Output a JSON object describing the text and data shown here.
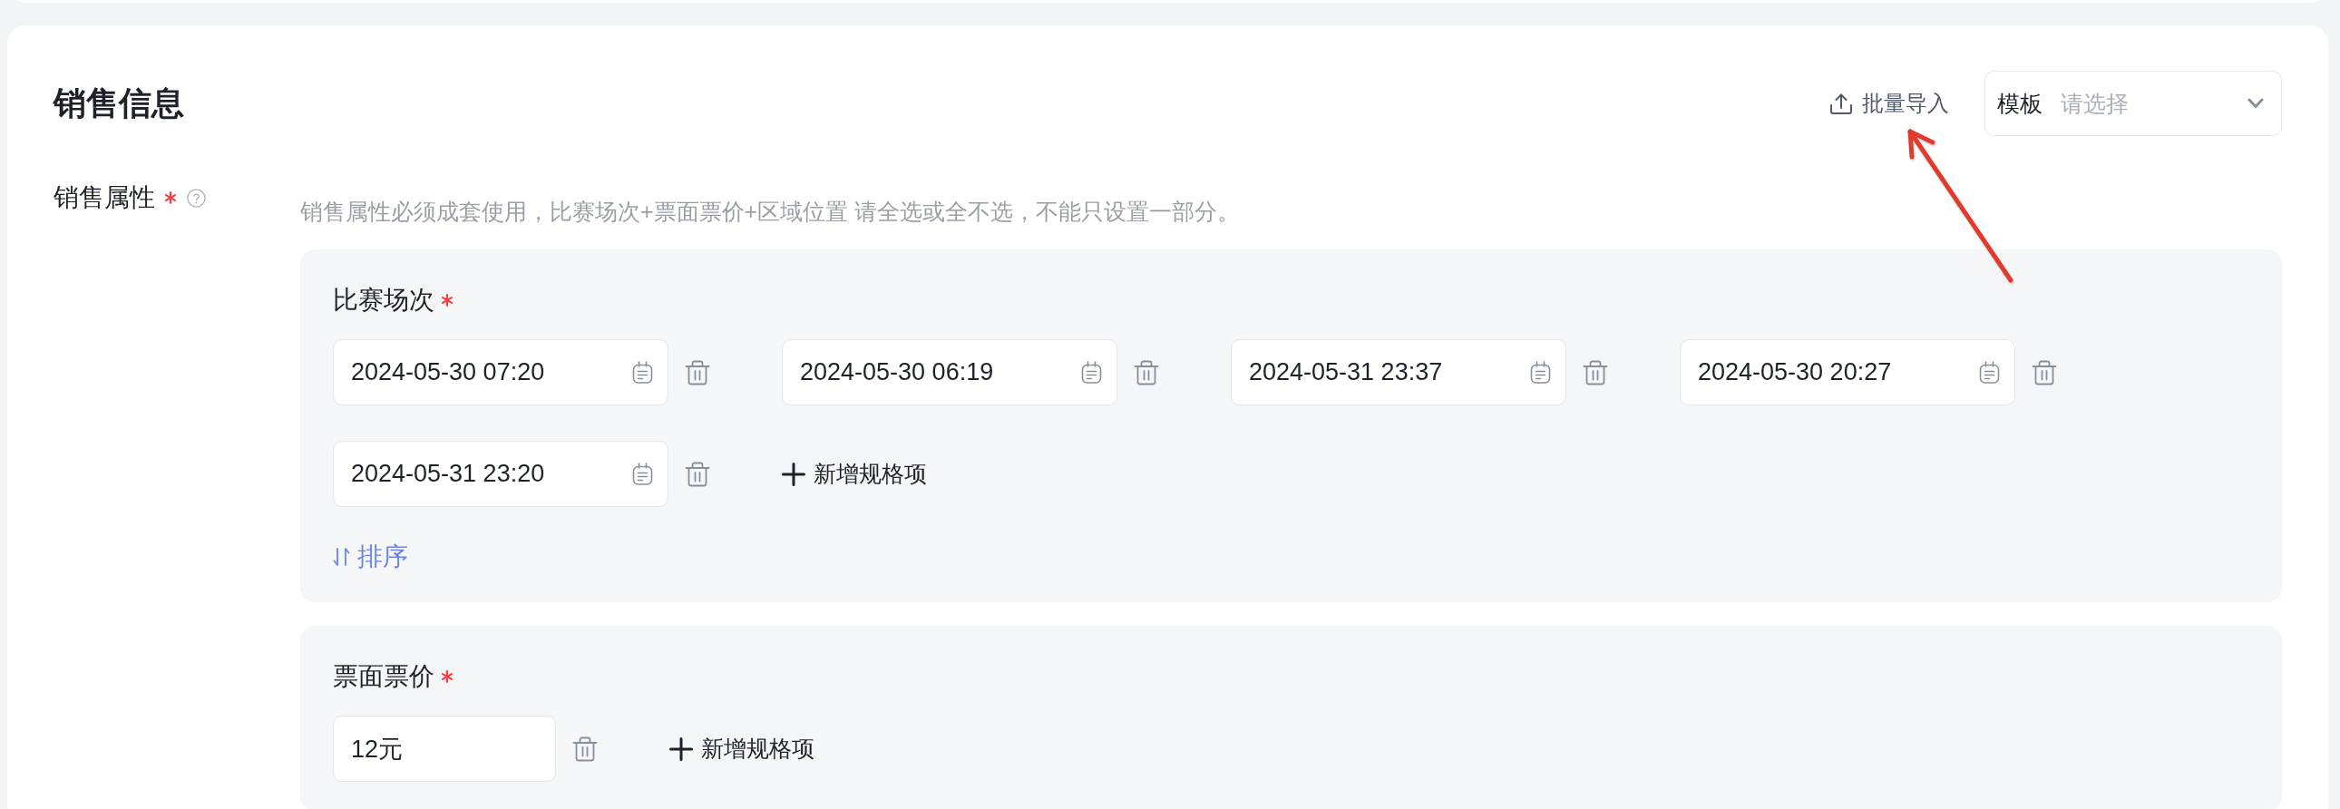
{
  "section": {
    "title": "销售信息",
    "import_button": "批量导入",
    "template_select": {
      "label": "模板",
      "placeholder": "请选择"
    }
  },
  "sales_attributes": {
    "label": "销售属性",
    "required": true,
    "hint": "销售属性必须成套使用，比赛场次+票面票价+区域位置 请全选或全不选，不能只设置一部分。",
    "groups": [
      {
        "title": "比赛场次",
        "required": true,
        "kind": "datetime",
        "values": [
          "2024-05-30 07:20",
          "2024-05-30 06:19",
          "2024-05-31 23:37",
          "2024-05-30 20:27",
          "2024-05-31 23:20"
        ],
        "add_button": "新增规格项",
        "sort_link": "排序"
      },
      {
        "title": "票面票价",
        "required": true,
        "kind": "text",
        "values": [
          "12元"
        ],
        "add_button": "新增规格项"
      }
    ]
  }
}
